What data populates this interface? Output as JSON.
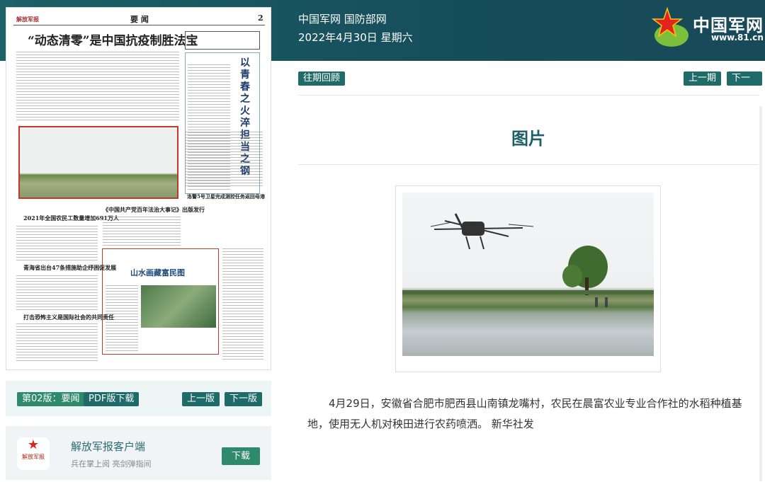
{
  "header": {
    "site": "中国军网 国防部网",
    "date": "2022年4月30日 星期六",
    "logo_text": "中国军网",
    "logo_url": "www.81.cn"
  },
  "newspaper": {
    "masthead": "解放军报",
    "section": "要 闻",
    "page_no": "2",
    "headlines": [
      "“动态清零”是中国抗疫制胜法宝",
      "以青春之火淬担当之钢",
      "2021年全国农民工数量增加691万人",
      "《中国共产党百年法治大事记》出版发行",
      "山水画藏富民图",
      "青海省出台47条措施助企纾困促发展",
      "打击恐怖主义是国际社会的共同责任",
      "洛警5号卫星完成测控任务返回母港"
    ]
  },
  "edition_bar": {
    "current": "第02版：要闻",
    "pdf": "PDF版下载",
    "prev": "上一版",
    "next": "下一版"
  },
  "app": {
    "name": "解放军报客户端",
    "slogan": "兵在掌上阅 亮剑弹指间",
    "download": "下载",
    "icon_text": "解放军报"
  },
  "nav": {
    "archive": "往期回顾",
    "prev": "上一期",
    "next": "下一期"
  },
  "article": {
    "title": "图片",
    "caption": "4月29日，安徽省合肥市肥西县山南镇龙嘴村，农民在晨富农业专业合作社的水稻种植基地，使用无人机对秧田进行农药喷洒。 新华社发"
  }
}
